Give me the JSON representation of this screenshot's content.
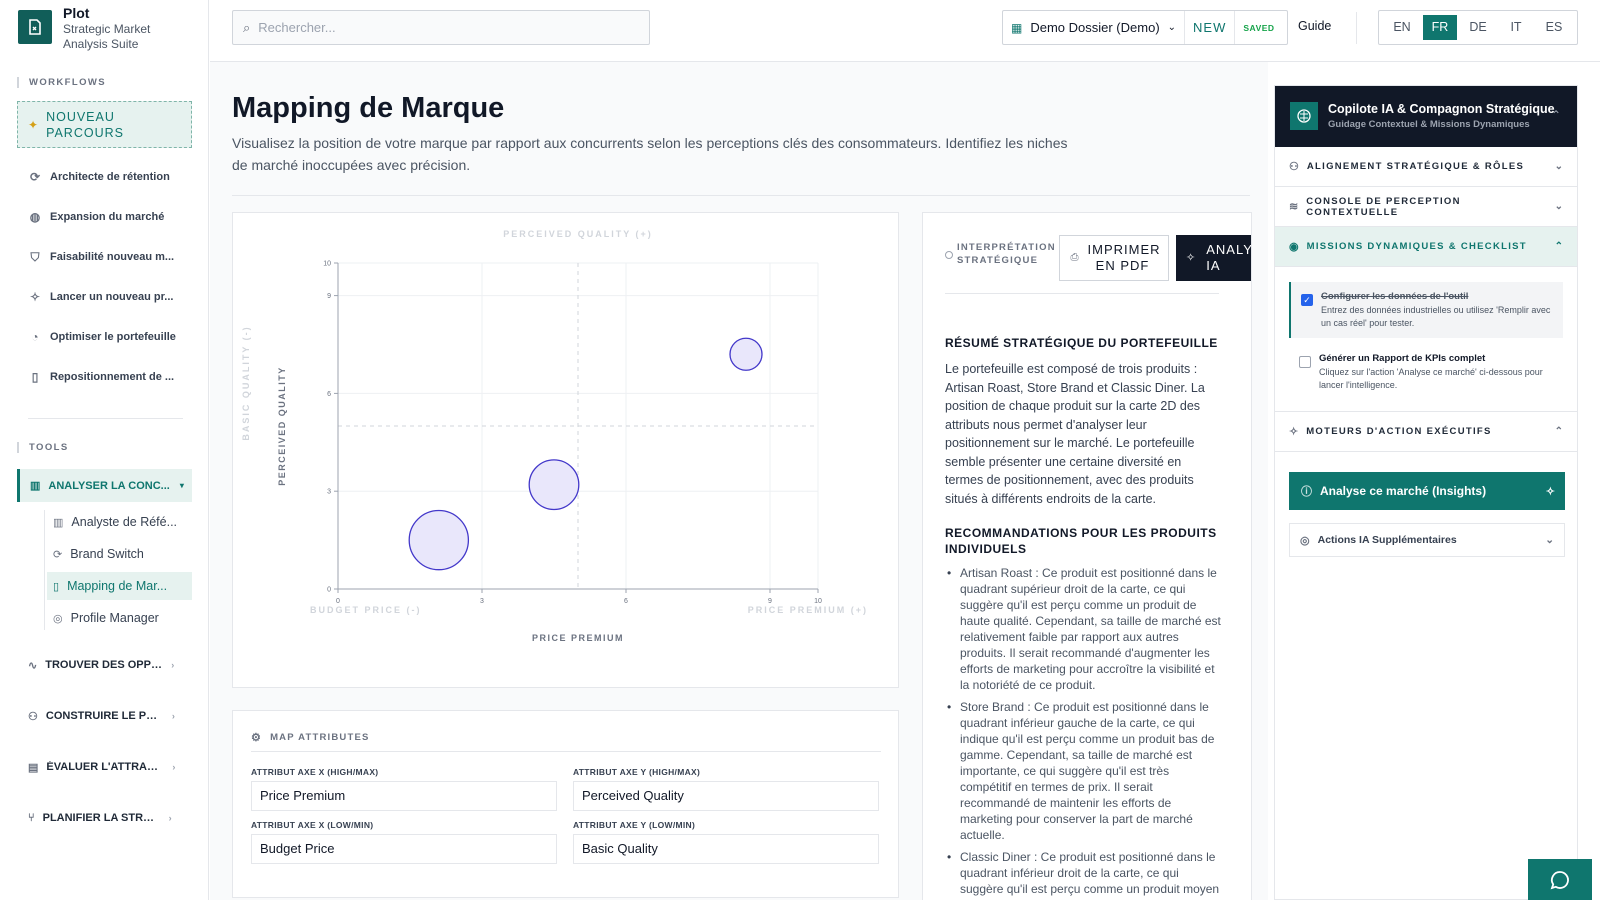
{
  "app": {
    "title": "Plot",
    "subtitle": "Strategic Market Analysis Suite"
  },
  "sidebar": {
    "workflows_label": "WORKFLOWS",
    "new_path_label": "NOUVEAU PARCOURS",
    "workflows": [
      {
        "label": "Architecte de rétention",
        "icon": "refresh-icon"
      },
      {
        "label": "Expansion du marché",
        "icon": "globe-icon"
      },
      {
        "label": "Faisabilité nouveau m...",
        "icon": "shield-icon"
      },
      {
        "label": "Lancer un nouveau pr...",
        "icon": "sparkle-icon"
      },
      {
        "label": "Optimiser le portefeuille",
        "icon": "pie-icon"
      },
      {
        "label": "Repositionnement de ...",
        "icon": "map-icon"
      }
    ],
    "tools_label": "TOOLS",
    "active_tool": "ANALYSER LA CONC...",
    "tool_items": [
      {
        "label": "Analyste de Réfé...",
        "icon": "bar-chart-icon"
      },
      {
        "label": "Brand Switch",
        "icon": "refresh-icon"
      },
      {
        "label": "Mapping de Mar...",
        "icon": "map-icon"
      },
      {
        "label": "Profile Manager",
        "icon": "fingerprint-icon"
      }
    ],
    "groups": [
      {
        "label": "TROUVER DES OPPOR...",
        "icon": "activity-icon"
      },
      {
        "label": "CONSTRUIRE LE POSI...",
        "icon": "nodes-icon"
      },
      {
        "label": "ÉVALUER L'ATTRACTI...",
        "icon": "calculator-icon"
      },
      {
        "label": "PLANIFIER LA STRATÉ...",
        "icon": "branch-icon"
      }
    ]
  },
  "topbar": {
    "search_placeholder": "Rechercher...",
    "dossier": "Demo Dossier (Demo)",
    "new_label": "NEW",
    "saved_label": "SAVED",
    "guide_label": "Guide",
    "languages": [
      "EN",
      "FR",
      "DE",
      "IT",
      "ES"
    ],
    "active_language": "FR"
  },
  "main": {
    "title": "Mapping de Marque",
    "description": "Visualisez la position de votre marque par rapport aux concurrents selon les perceptions clés des consommateurs. Identifiez les niches de marché inoccupées avec précision."
  },
  "chart_data": {
    "type": "scatter",
    "top_label": "PERCEIVED QUALITY (+)",
    "left_label": "BASIC QUALITY (-)",
    "bottom_left_label": "BUDGET PRICE (-)",
    "bottom_right_label": "PRICE PREMIUM (+)",
    "xlabel": "PRICE PREMIUM",
    "ylabel": "PERCEIVED QUALITY",
    "xlim": [
      0,
      10
    ],
    "ylim": [
      0,
      10
    ],
    "xticks": [
      0,
      3,
      6,
      9,
      10
    ],
    "yticks": [
      0,
      3,
      6,
      9,
      10
    ],
    "midlines": {
      "x": 5,
      "y": 5
    },
    "points": [
      {
        "x": 8.5,
        "y": 7.2,
        "size": 1.0
      },
      {
        "x": 4.5,
        "y": 3.2,
        "size": 1.55
      },
      {
        "x": 2.1,
        "y": 1.5,
        "size": 1.85
      }
    ],
    "color": "#4338ca",
    "fill": "#e9e7fb"
  },
  "attributes": {
    "title": "MAP ATTRIBUTES",
    "x_high_label": "ATTRIBUT AXE X (HIGH/MAX)",
    "x_high_value": "Price Premium",
    "y_high_label": "ATTRIBUT AXE Y (HIGH/MAX)",
    "y_high_value": "Perceived Quality",
    "x_low_label": "ATTRIBUT AXE X (LOW/MIN)",
    "x_low_value": "Budget Price",
    "y_low_label": "ATTRIBUT AXE Y (LOW/MIN)",
    "y_low_value": "Basic Quality"
  },
  "interpretation": {
    "header": "INTERPRÉTATION STRATÉGIQUE",
    "print_label": "IMPRIMER EN PDF",
    "ai_label": "ANALYS IA",
    "summary_title": "RÉSUMÉ STRATÉGIQUE DU PORTEFEUILLE",
    "summary_text": "Le portefeuille est composé de trois produits : Artisan Roast, Store Brand et Classic Diner. La position de chaque produit sur la carte 2D des attributs nous permet d'analyser leur positionnement sur le marché. Le portefeuille semble présenter une certaine diversité en termes de positionnement, avec des produits situés à différents endroits de la carte.",
    "reco_title": "RECOMMANDATIONS POUR LES PRODUITS INDIVIDUELS",
    "recommendations": [
      "Artisan Roast : Ce produit est positionné dans le quadrant supérieur droit de la carte, ce qui suggère qu'il est perçu comme un produit de haute qualité. Cependant, sa taille de marché est relativement faible par rapport aux autres produits. Il serait recommandé d'augmenter les efforts de marketing pour accroître la visibilité et la notoriété de ce produit.",
      "Store Brand : Ce produit est positionné dans le quadrant inférieur gauche de la carte, ce qui indique qu'il est perçu comme un produit bas de gamme. Cependant, sa taille de marché est importante, ce qui suggère qu'il est très compétitif en termes de prix. Il serait recommandé de maintenir les efforts de marketing pour conserver la part de marché actuelle.",
      "Classic Diner : Ce produit est positionné dans le quadrant inférieur droit de la carte, ce qui suggère qu'il est perçu comme un produit moyen de gamme. Sa taille de marché est"
    ]
  },
  "copilot": {
    "title": "Copilote IA & Compagnon Stratégique",
    "subtitle": "Guidage Contextuel & Missions Dynamiques",
    "sections": [
      "ALIGNEMENT STRATÉGIQUE & RÔLES",
      "CONSOLE DE PERCEPTION CONTEXTUELLE",
      "MISSIONS DYNAMIQUES & CHECKLIST"
    ],
    "tasks": [
      {
        "title": "Configurer les données de l'outil",
        "desc": "Entrez des données industrielles ou utilisez 'Remplir avec un cas réel' pour tester."
      },
      {
        "title": "Générer un Rapport de KPIs complet",
        "desc": "Cliquez sur l'action 'Analyse ce marché' ci-dessous pour lancer l'intelligence."
      }
    ],
    "engines_label": "MOTEURS D'ACTION EXÉCUTIFS",
    "analyse_label": "Analyse ce marché (Insights)",
    "more_label": "Actions IA Supplémentaires"
  }
}
